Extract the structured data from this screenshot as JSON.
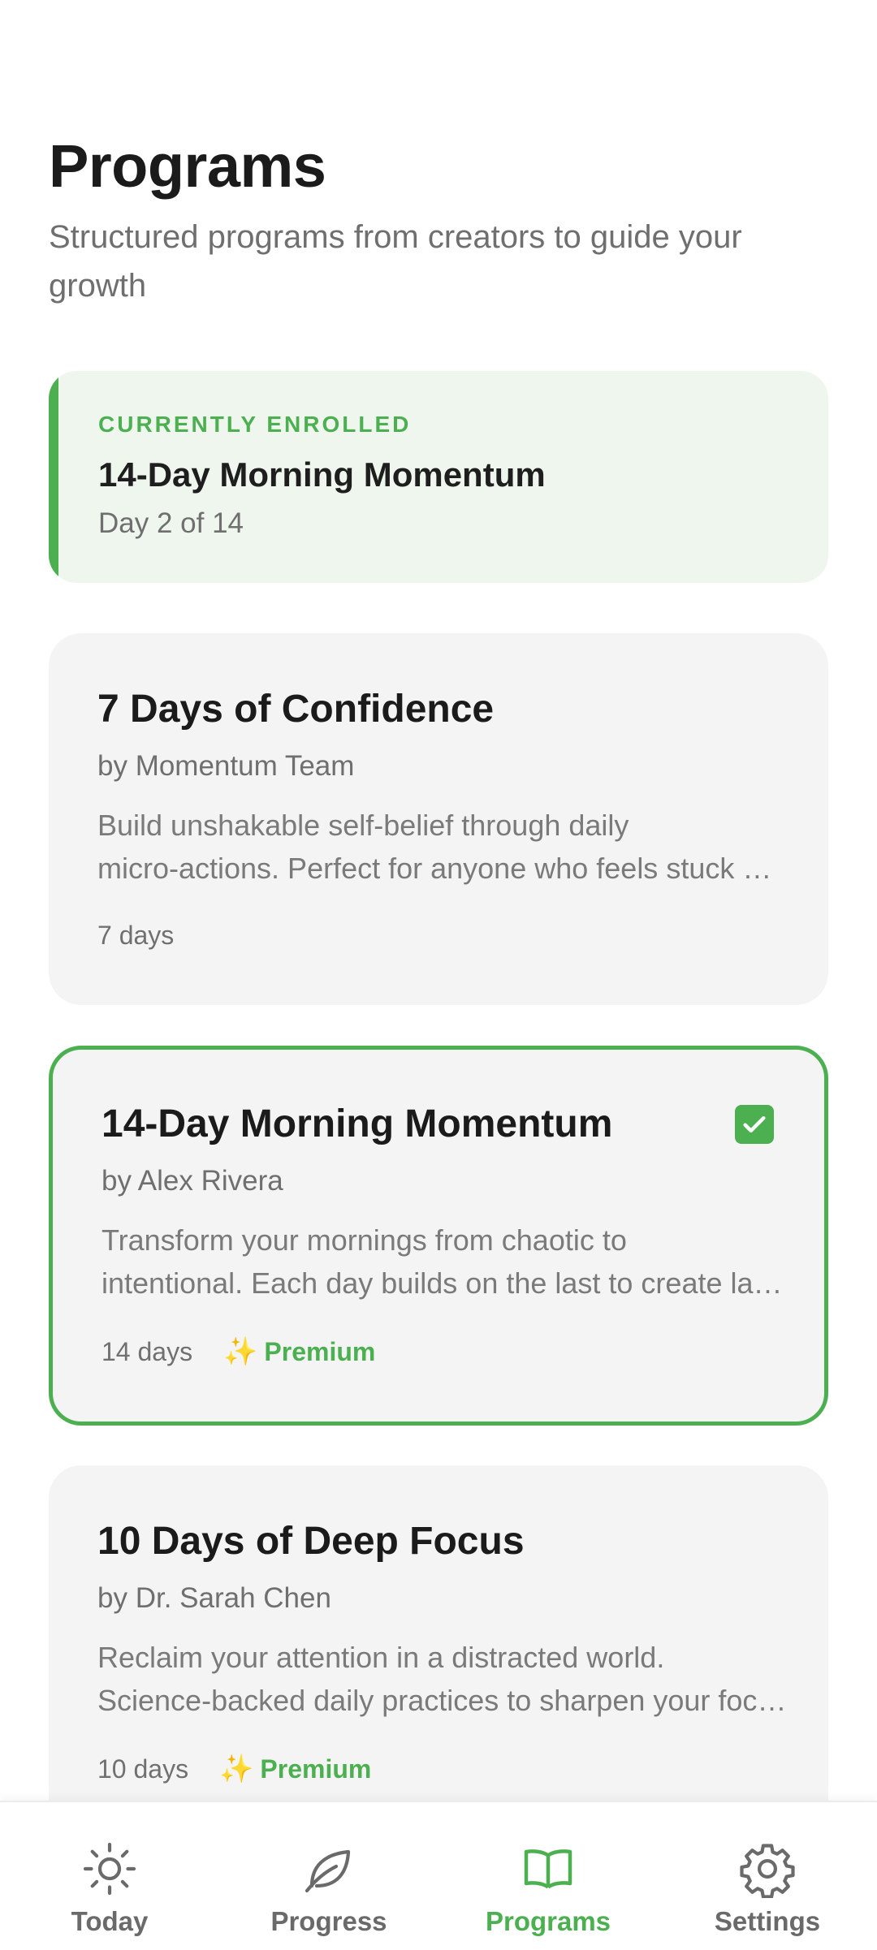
{
  "header": {
    "title": "Programs",
    "subtitle": "Structured programs from creators to guide your growth"
  },
  "enrolled": {
    "label": "CURRENTLY ENROLLED",
    "title": "14-Day Morning Momentum",
    "progress": "Day 2 of 14"
  },
  "programs": [
    {
      "title": "7 Days of Confidence",
      "author": "by Momentum Team",
      "desc_line1": "Build unshakable self-belief through daily",
      "desc_line2": "micro-actions. Perfect for anyone who feels stuck or hesitant.",
      "duration": "7 days",
      "premium": ""
    },
    {
      "title": "14-Day Morning Momentum",
      "author": "by Alex Rivera",
      "desc_line1": "Transform your mornings from chaotic to",
      "desc_line2": "intentional. Each day builds on the last to create lasting habits.",
      "duration": "14 days",
      "premium": "Premium",
      "selected": true
    },
    {
      "title": "10 Days of Deep Focus",
      "author": "by Dr. Sarah Chen",
      "desc_line1": "Reclaim your attention in a distracted world.",
      "desc_line2": "Science-backed daily practices to sharpen your focus and clarity.",
      "duration": "10 days",
      "premium": "Premium"
    }
  ],
  "nav": {
    "items": [
      {
        "label": "Today",
        "icon": "sun-icon"
      },
      {
        "label": "Progress",
        "icon": "leaf-icon"
      },
      {
        "label": "Programs",
        "icon": "book-icon",
        "active": true
      },
      {
        "label": "Settings",
        "icon": "gear-icon"
      }
    ]
  },
  "colors": {
    "accent": "#4caf50",
    "card_bg": "#f4f4f4",
    "enrolled_bg": "#eef6ee",
    "muted_text": "#6f6f6f"
  }
}
